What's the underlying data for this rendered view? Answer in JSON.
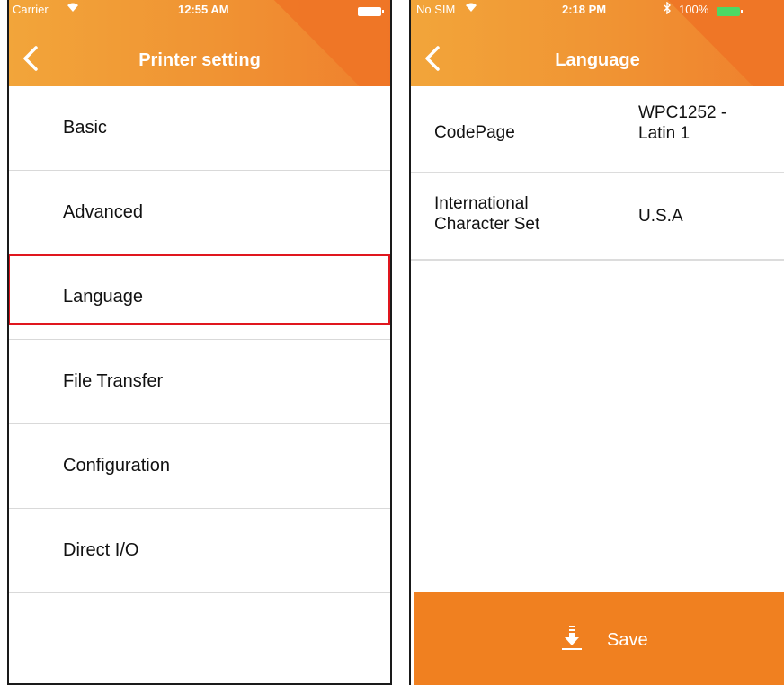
{
  "left_screen": {
    "status": {
      "carrier": "Carrier",
      "time": "12:55 AM"
    },
    "nav": {
      "title": "Printer setting"
    },
    "menu": [
      "Basic",
      "Advanced",
      "Language",
      "File Transfer",
      "Configuration",
      "Direct I/O"
    ],
    "highlighted_item": "Language"
  },
  "right_screen": {
    "status": {
      "carrier": "No SIM",
      "time": "2:18 PM",
      "battery": "100%"
    },
    "nav": {
      "title": "Language"
    },
    "settings": [
      {
        "name": "CodePage",
        "value": "WPC1252 -\nLatin 1"
      },
      {
        "name": "International\nCharacter Set",
        "value": "U.S.A"
      }
    ],
    "save_label": "Save"
  },
  "colors": {
    "accent": "#f08020",
    "highlight": "#e0161e"
  }
}
